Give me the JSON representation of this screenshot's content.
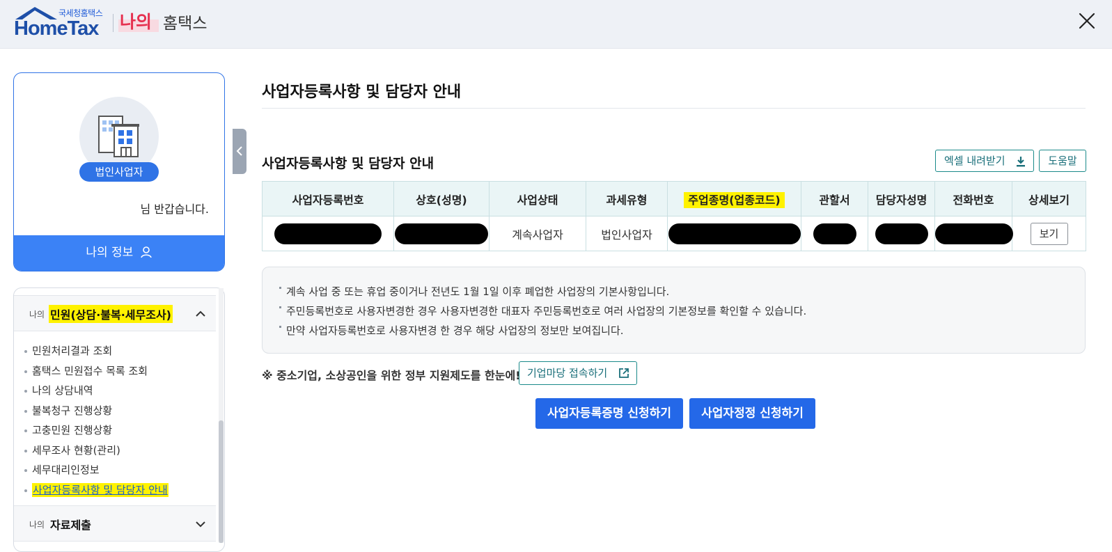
{
  "header": {
    "logo_small": "국세청홈택스",
    "logo_main": "HomeTax",
    "my_label": "나의",
    "service_label": "홈택스",
    "close_icon": "close-icon"
  },
  "profile": {
    "avatar_icon": "building-icon",
    "badge": "법인사업자",
    "greeting": "님 반갑습니다.",
    "my_info_button": "나의 정보",
    "my_info_icon": "person-icon"
  },
  "menu": {
    "section1": {
      "prefix": "나의",
      "title": "민원(상담·불복·세무조사)",
      "expanded": true
    },
    "items": [
      {
        "label": "민원처리결과 조회"
      },
      {
        "label": "홈택스 민원접수 목록 조회"
      },
      {
        "label": "나의 상담내역"
      },
      {
        "label": "불복청구 진행상황"
      },
      {
        "label": "고충민원 진행상황"
      },
      {
        "label": "세무조사 현황(관리)"
      },
      {
        "label": "세무대리인정보"
      },
      {
        "label": "사업자등록사항 및 담당자 안내",
        "active": true
      }
    ],
    "section2": {
      "prefix": "나의",
      "title": "자료제출",
      "expanded": false
    }
  },
  "main": {
    "page_title": "사업자등록사항 및 담당자 안내",
    "section_title": "사업자등록사항 및 담당자 안내",
    "excel_button": "엑셀 내려받기",
    "help_button": "도움말",
    "table": {
      "headers": [
        "사업자등록번호",
        "상호(성명)",
        "사업상태",
        "과세유형",
        "주업종명(업종코드)",
        "관할서",
        "담당자성명",
        "전화번호",
        "상세보기"
      ],
      "row": {
        "status": "계속사업자",
        "tax_type": "법인사업자",
        "view_button": "보기"
      }
    },
    "notices": [
      "계속 사업 중 또는 휴업 중이거나 전년도 1월 1일 이후 폐업한 사업장의 기본사항입니다.",
      "주민등록번호로 사용자변경한 경우 사용자변경한 대표자 주민등록번호로 여러 사업장의 기본정보를 확인할 수 있습니다.",
      "만약 사업자등록번호로 사용자변경 한 경우 해당 사업장의 정보만 보여집니다."
    ],
    "promo_text": "※ 중소기업, 소상공인을 위한 정부 지원제도를 한눈에!",
    "promo_button": "기업마당 접속하기",
    "cert_button": "사업자등록증명 신청하기",
    "correction_button": "사업자정정 신청하기"
  },
  "colors": {
    "primary": "#2468e8",
    "brand_blue": "#1e4fa8",
    "accent_red": "#e6304f",
    "teal": "#1a8a8a",
    "highlight": "#fff200"
  }
}
